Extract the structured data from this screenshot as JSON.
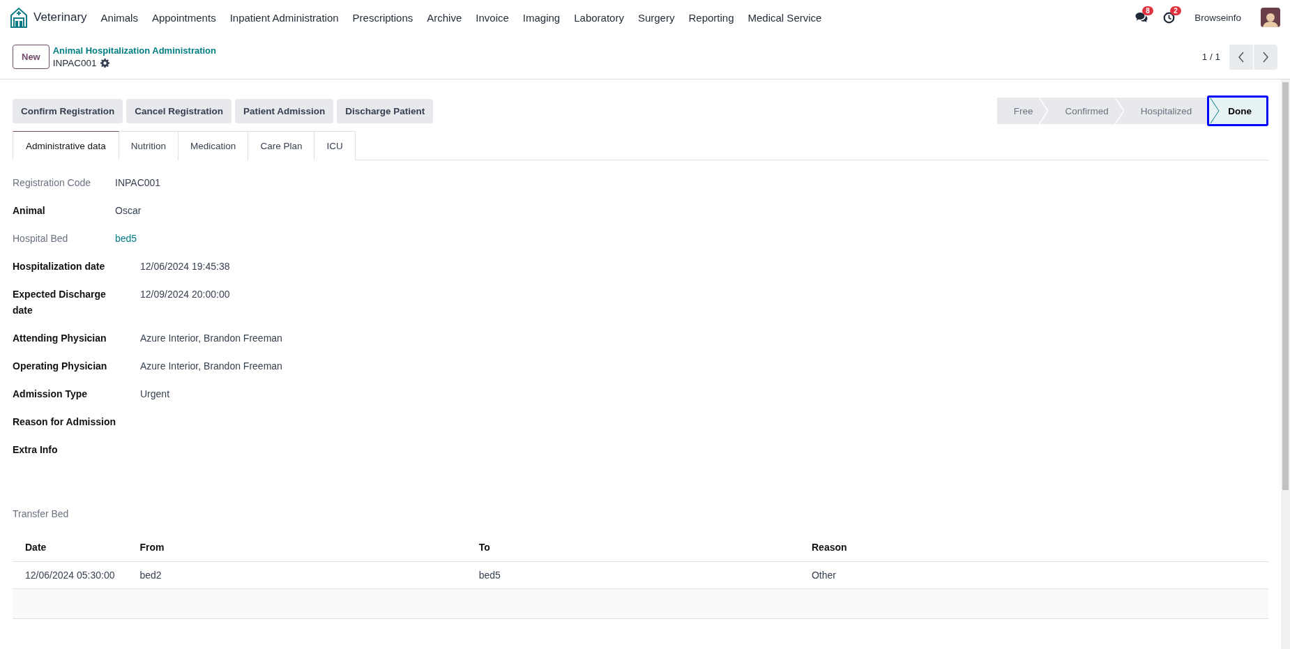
{
  "navbar": {
    "app_name": "Veterinary",
    "menu": [
      "Animals",
      "Appointments",
      "Inpatient Administration",
      "Prescriptions",
      "Archive",
      "Invoice",
      "Imaging",
      "Laboratory",
      "Surgery",
      "Reporting",
      "Medical Service"
    ],
    "messages_badge": "8",
    "activities_badge": "2",
    "user": "Browseinfo"
  },
  "breadcrumb": {
    "new_button": "New",
    "parent": "Animal Hospitalization Administration",
    "record": "INPAC001"
  },
  "pager": {
    "text": "1 / 1"
  },
  "actions": [
    "Confirm Registration",
    "Cancel Registration",
    "Patient Admission",
    "Discharge Patient"
  ],
  "status_steps": [
    {
      "label": "Free",
      "selected": false
    },
    {
      "label": "Confirmed",
      "selected": false
    },
    {
      "label": "Hospitalized",
      "selected": false
    },
    {
      "label": "Done",
      "selected": true
    }
  ],
  "tabs": [
    {
      "label": "Administrative data",
      "selected": true
    },
    {
      "label": "Nutrition",
      "selected": false
    },
    {
      "label": "Medication",
      "selected": false
    },
    {
      "label": "Care Plan",
      "selected": false
    },
    {
      "label": "ICU",
      "selected": false
    }
  ],
  "field_groups": [
    {
      "fields": [
        {
          "label": "Registration Code",
          "value": "INPAC001",
          "readonly": true,
          "link": false
        },
        {
          "label": "Animal",
          "value": "Oscar",
          "readonly": false,
          "link": false
        },
        {
          "label": "Hospital Bed",
          "value": "bed5",
          "readonly": true,
          "link": true
        }
      ]
    },
    {
      "fields": [
        {
          "label": "Hospitalization date",
          "value": "12/06/2024 19:45:38",
          "readonly": false,
          "link": false
        },
        {
          "label": "Expected Discharge date",
          "value": "12/09/2024 20:00:00",
          "readonly": false,
          "link": false
        },
        {
          "label": "Attending Physician",
          "value": "Azure Interior, Brandon Freeman",
          "readonly": false,
          "link": false
        },
        {
          "label": "Operating Physician",
          "value": "Azure Interior, Brandon Freeman",
          "readonly": false,
          "link": false
        },
        {
          "label": "Admission Type",
          "value": "Urgent",
          "readonly": false,
          "link": false
        },
        {
          "label": "Reason for Admission",
          "readonly": false
        },
        {
          "label": "Extra Info",
          "readonly": false
        }
      ]
    }
  ],
  "transfer_bed": {
    "title": "Transfer Bed",
    "columns": [
      "Date",
      "From",
      "To",
      "Reason"
    ],
    "rows": [
      [
        "12/06/2024 05:30:00",
        "bed2",
        "bed5",
        "Other"
      ]
    ]
  }
}
